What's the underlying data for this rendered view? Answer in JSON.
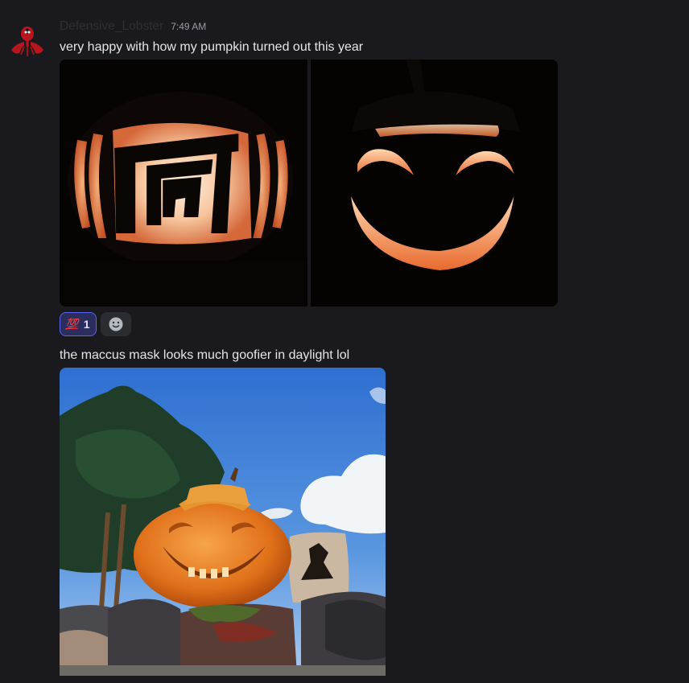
{
  "messages": [
    {
      "author": "Defensive_Lobster",
      "timestamp": "7:49 AM",
      "text": "very happy with how my pumpkin turned out this year",
      "attachments": [
        "jack-o-lantern-g-logo",
        "jack-o-lantern-heart-eyes-smile"
      ],
      "reactions": [
        {
          "emoji": "💯",
          "count": "1",
          "active": true
        }
      ],
      "add_reaction_icon": "smiley-add-reaction-icon"
    },
    {
      "text": "the maccus mask looks much goofier in daylight lol",
      "attachments": [
        "pumpkin-daylight-photo"
      ]
    }
  ],
  "colors": {
    "background": "#1a1a1e",
    "text": "#e3e5e8",
    "reaction_active_bg": "#2b2d5e",
    "reaction_active_border": "#5865f2",
    "avatar_red": "#c0151b"
  }
}
